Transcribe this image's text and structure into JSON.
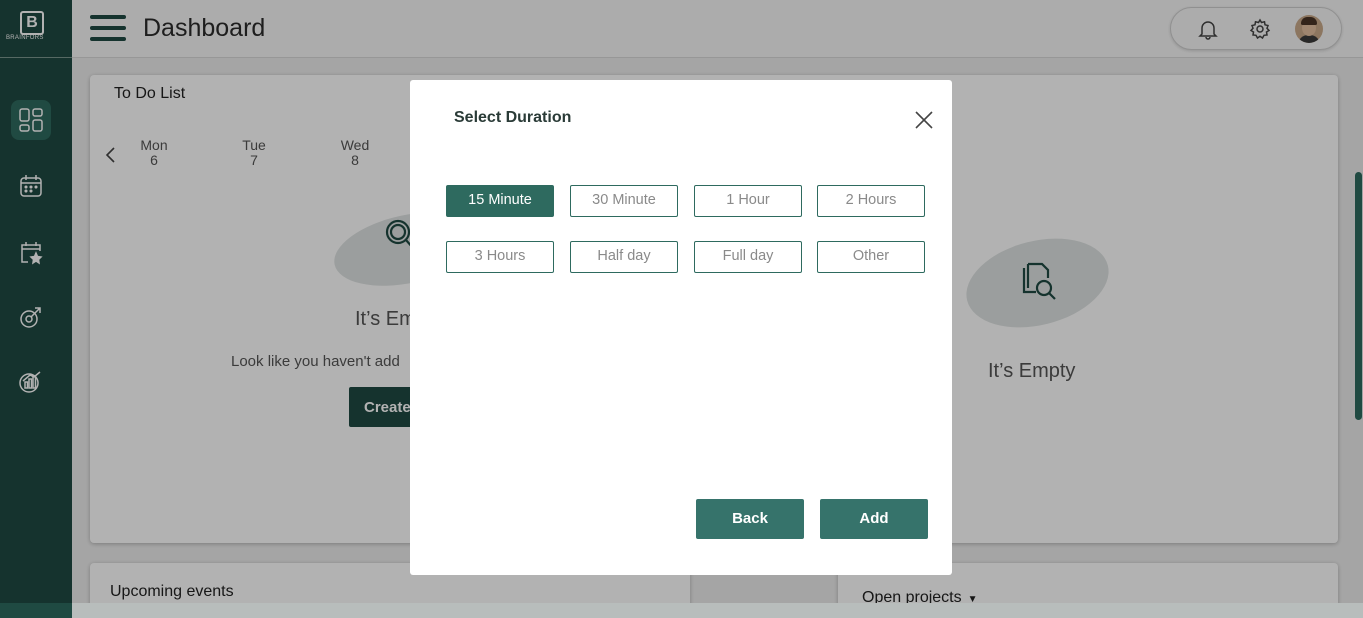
{
  "brand": {
    "logo_letter": "B",
    "name": "BRAINFORS"
  },
  "header": {
    "title": "Dashboard"
  },
  "sidebar": {
    "items": [
      {
        "icon": "dashboard-icon",
        "active": true
      },
      {
        "icon": "calendar-icon",
        "active": false
      },
      {
        "icon": "starred-calendar-icon",
        "active": false
      },
      {
        "icon": "rocket-icon",
        "active": false
      },
      {
        "icon": "growth-chart-icon",
        "active": false
      }
    ]
  },
  "todo": {
    "title": "To Do List",
    "days": [
      {
        "name": "Mon",
        "num": "6"
      },
      {
        "name": "Tue",
        "num": "7"
      },
      {
        "name": "Wed",
        "num": "8"
      }
    ],
    "empty_title": "It’s Em",
    "empty_sub": "Look like you haven't add",
    "create_label": "Create"
  },
  "right_panel": {
    "empty_title": "It’s Empty"
  },
  "upcoming": {
    "title": "Upcoming events"
  },
  "projects": {
    "title": "Open projects",
    "caret": "▼"
  },
  "modal": {
    "title": "Select Duration",
    "options": [
      {
        "label": "15 Minute",
        "selected": true
      },
      {
        "label": "30 Minute",
        "selected": false
      },
      {
        "label": "1 Hour",
        "selected": false
      },
      {
        "label": "2 Hours",
        "selected": false
      },
      {
        "label": "3 Hours",
        "selected": false
      },
      {
        "label": "Half day",
        "selected": false
      },
      {
        "label": "Full day",
        "selected": false
      },
      {
        "label": "Other",
        "selected": false
      }
    ],
    "back_label": "Back",
    "add_label": "Add"
  },
  "colors": {
    "primary": "#1f4a42",
    "accent": "#2e6a5f",
    "button": "#36736b"
  }
}
